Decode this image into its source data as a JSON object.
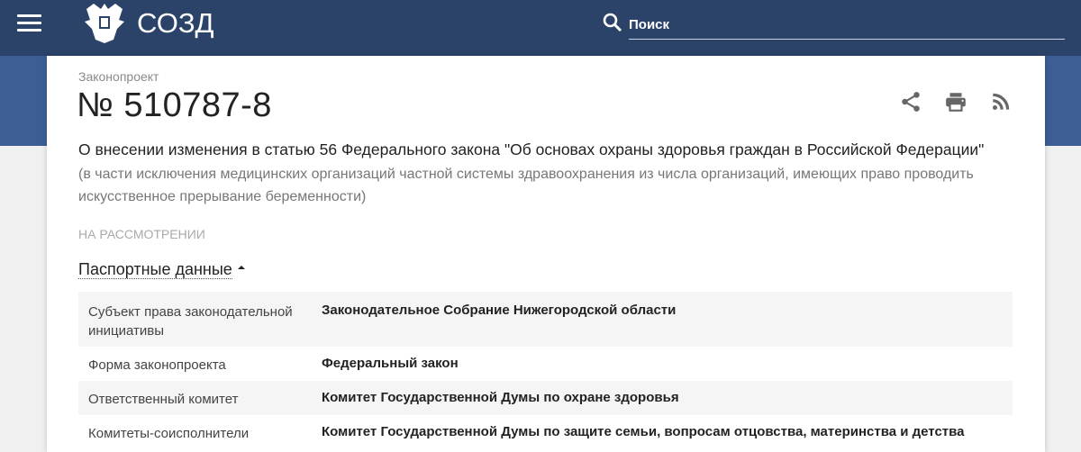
{
  "header": {
    "brand": "СОЗД",
    "search_placeholder": "Поиск"
  },
  "bill": {
    "kind": "Законопроект",
    "number": "№ 510787-8",
    "title": "О внесении изменения в статью 56 Федерального закона \"Об основах охраны здоровья граждан в Российской Федерации\"",
    "subtitle": "(в части исключения медицинских организаций частной системы здравоохранения из числа организаций, имеющих право проводить искусственное прерывание беременности)",
    "status": "НА РАССМОТРЕНИИ"
  },
  "passport": {
    "label": "Паспортные данные",
    "rows": [
      {
        "key": "Субъект права законодательной инициативы",
        "value": "Законодательное Собрание Нижегородской области"
      },
      {
        "key": "Форма законопроекта",
        "value": "Федеральный закон"
      },
      {
        "key": "Ответственный комитет",
        "value": "Комитет Государственной Думы по охране здоровья"
      },
      {
        "key": "Комитеты-соисполнители",
        "value": "Комитет Государственной Думы по защите семьи, вопросам отцовства, материнства и детства"
      }
    ]
  },
  "colors": {
    "header": "#2c4369",
    "band": "#3d5e95"
  }
}
